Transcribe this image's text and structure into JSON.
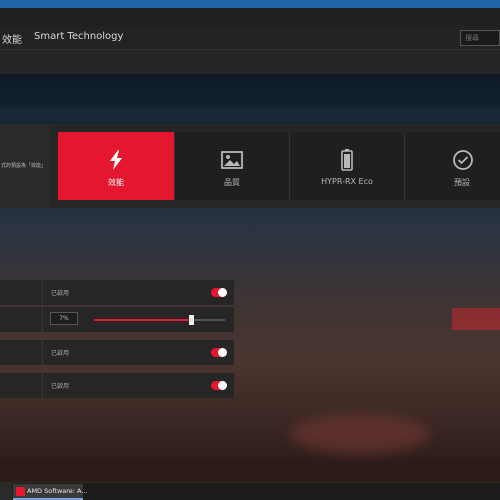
{
  "nav": {
    "tab_performance": "效能",
    "tab_smart_technology": "Smart Technology",
    "search_placeholder": "搜尋"
  },
  "profile": {
    "left_caption": "式的預設為「效能」",
    "tiles": [
      {
        "label": "效能",
        "icon": "lightning-icon",
        "active": true
      },
      {
        "label": "品質",
        "icon": "image-icon",
        "active": false
      },
      {
        "label": "HYPR-RX Eco",
        "icon": "battery-icon",
        "active": false
      },
      {
        "label": "預設",
        "icon": "checkmark-circle-icon",
        "active": false
      }
    ]
  },
  "settings": {
    "row1_status": "已啟用",
    "row2_value": "7%",
    "row2_slider_level": 0.74,
    "row3_status": "已啟用",
    "row4_status": "已啟用"
  },
  "taskbar": {
    "app_label": "AMD Software: A..."
  },
  "colors": {
    "accent": "#e5162f",
    "panel": "#262626",
    "tile": "#1f1f1f",
    "taskbar_highlight": "#7aa7d8"
  }
}
